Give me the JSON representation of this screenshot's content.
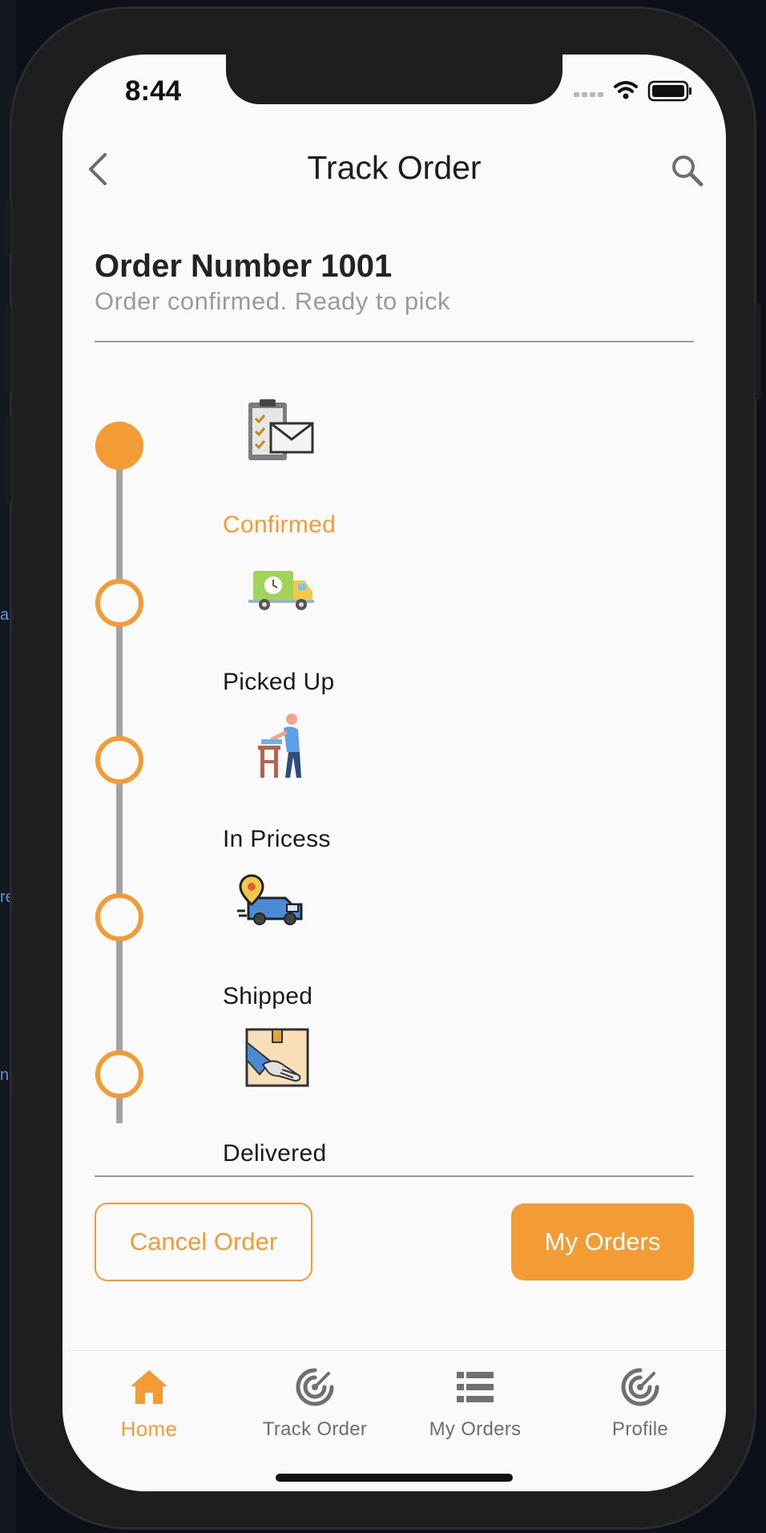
{
  "status_bar": {
    "time": "8:44"
  },
  "header": {
    "title": "Track Order"
  },
  "order": {
    "title": "Order Number 1001",
    "subtitle": "Order confirmed. Ready to pick"
  },
  "timeline": {
    "steps": [
      {
        "label": "Confirmed",
        "icon": "clipboard-envelope-icon",
        "completed": true
      },
      {
        "label": "Picked Up",
        "icon": "delivery-truck-clock-icon",
        "completed": false
      },
      {
        "label": "In Pricess",
        "icon": "person-packing-icon",
        "completed": false
      },
      {
        "label": "Shipped",
        "icon": "van-location-icon",
        "completed": false
      },
      {
        "label": "Delivered",
        "icon": "hand-package-icon",
        "completed": false
      }
    ]
  },
  "actions": {
    "cancel_label": "Cancel Order",
    "orders_label": "My Orders"
  },
  "bottom_nav": {
    "items": [
      {
        "label": "Home",
        "icon": "home-icon",
        "active": true
      },
      {
        "label": "Track Order",
        "icon": "track-radar-icon",
        "active": false
      },
      {
        "label": "My Orders",
        "icon": "list-icon",
        "active": false
      },
      {
        "label": "Profile",
        "icon": "profile-radar-icon",
        "active": false
      }
    ]
  },
  "colors": {
    "accent": "#f39c35",
    "line": "#a3a3a3",
    "text_dark": "#1b1b1b",
    "text_muted": "#9b9b9b"
  }
}
